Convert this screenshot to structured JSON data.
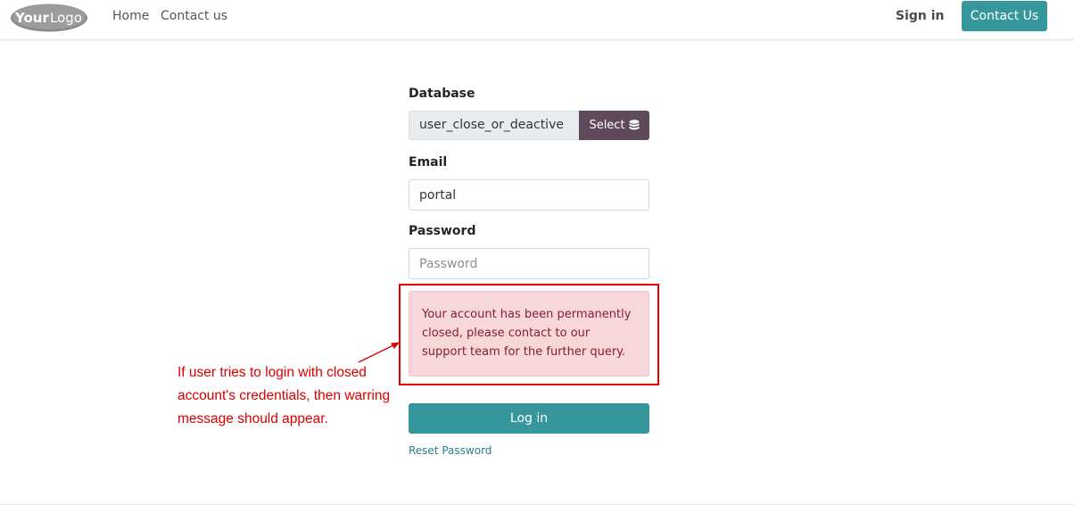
{
  "navbar": {
    "logo_text_bold": "Your",
    "logo_text_light": "Logo",
    "links": [
      {
        "label": "Home"
      },
      {
        "label": "Contact us"
      }
    ],
    "sign_in": "Sign in",
    "contact_button": "Contact Us"
  },
  "form": {
    "database_label": "Database",
    "database_value": "user_close_or_deactive",
    "select_button": "Select",
    "email_label": "Email",
    "email_value": "portal",
    "password_label": "Password",
    "password_placeholder": "Password",
    "alert_text": "Your account has been permanently closed, please contact to our support team for the further query.",
    "login_button": "Log in",
    "reset_link": "Reset Password"
  },
  "annotation": {
    "text": "If user tries to login with closed account's credentials, then warring message should appear."
  },
  "colors": {
    "primary": "#35979c",
    "secondary": "#5e4a5b",
    "alert_bg": "#f8d7da",
    "annotation": "#d80000"
  }
}
